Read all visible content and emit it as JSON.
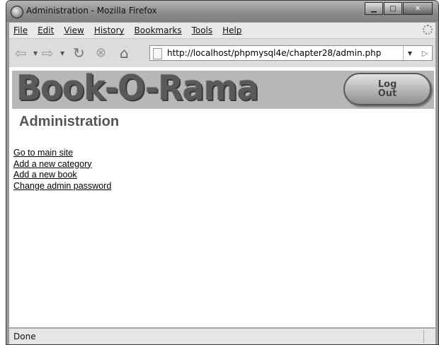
{
  "window": {
    "title": "Administration - Mozilla Firefox"
  },
  "menu": [
    "File",
    "Edit",
    "View",
    "History",
    "Bookmarks",
    "Tools",
    "Help"
  ],
  "toolbar": {
    "url": "http://localhost/phpmysql4e/chapter28/admin.php"
  },
  "page": {
    "logo_text": "Book-O-Rama",
    "logout_label": "Log Out",
    "heading": "Administration",
    "links": [
      "Go to main site",
      "Add a new category",
      "Add a new book",
      "Change admin password"
    ]
  },
  "status": {
    "text": "Done"
  }
}
